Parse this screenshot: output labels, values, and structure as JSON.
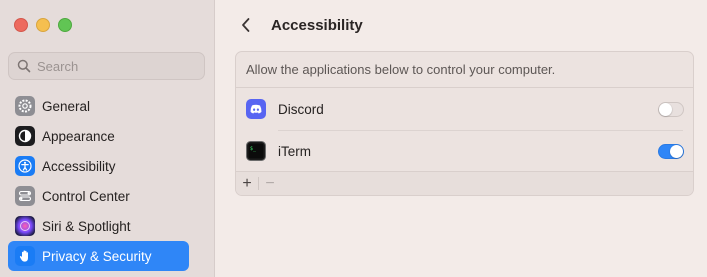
{
  "window": {
    "traffic_lights": [
      "close",
      "minimize",
      "zoom"
    ]
  },
  "search": {
    "placeholder": "Search",
    "value": ""
  },
  "sidebar": {
    "items": [
      {
        "label": "General",
        "icon": "gear-icon",
        "icon_bg": "#8e8e93",
        "active": false
      },
      {
        "label": "Appearance",
        "icon": "appearance-icon",
        "icon_bg": "#1c1c1e",
        "active": false
      },
      {
        "label": "Accessibility",
        "icon": "accessibility-icon",
        "icon_bg": "#1a7cf5",
        "active": false
      },
      {
        "label": "Control Center",
        "icon": "control-center-icon",
        "icon_bg": "#8e8e93",
        "active": false
      },
      {
        "label": "Siri & Spotlight",
        "icon": "siri-icon",
        "icon_bg": "#2b2b6e",
        "active": false
      },
      {
        "label": "Privacy & Security",
        "icon": "hand-icon",
        "icon_bg": "#1a7cf5",
        "active": true
      }
    ]
  },
  "header": {
    "title": "Accessibility",
    "back_icon": "chevron-left-icon"
  },
  "panel": {
    "description": "Allow the applications below to control your computer.",
    "apps": [
      {
        "name": "Discord",
        "icon": "discord-icon",
        "enabled": false
      },
      {
        "name": "iTerm",
        "icon": "iterm-icon",
        "enabled": true
      }
    ],
    "footer": {
      "add_label": "+",
      "remove_label": "−"
    }
  },
  "colors": {
    "accent": "#2f86f7",
    "sidebar_bg": "#e5dcda",
    "main_bg": "#f3ebe8"
  }
}
